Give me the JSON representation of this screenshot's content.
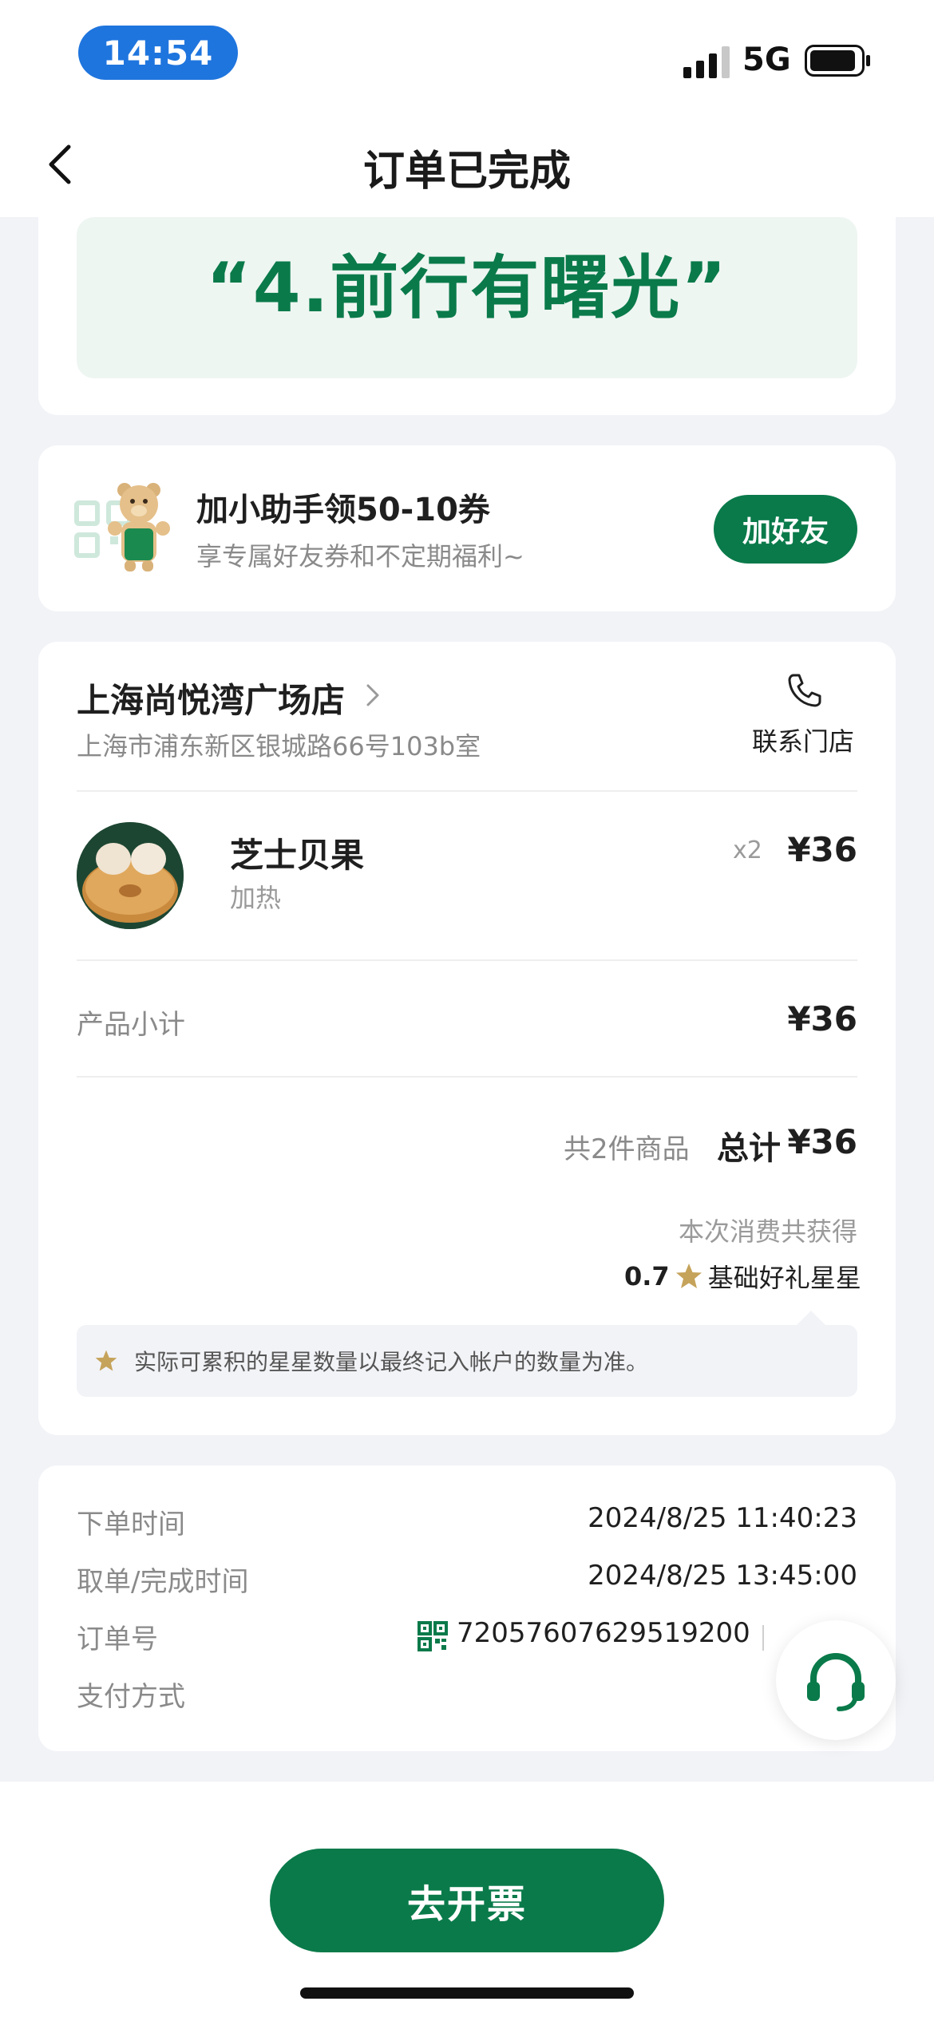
{
  "status_bar": {
    "time": "14:54",
    "network": "5G"
  },
  "nav": {
    "title": "订单已完成"
  },
  "quote": {
    "text": "“4.前行有曙光”"
  },
  "promo": {
    "title": "加小助手领50-10券",
    "subtitle": "享专属好友券和不定期福利~",
    "button": "加好友"
  },
  "store": {
    "name": "上海尚悦湾广场店",
    "address": "上海市浦东新区银城路66号103b室",
    "contact_label": "联系门店"
  },
  "product": {
    "name": "芝士贝果",
    "option": "加热",
    "qty": "x2",
    "price": "¥36"
  },
  "summary": {
    "subtotal_label": "产品小计",
    "subtotal_value": "¥36",
    "items_count": "共2件商品",
    "total_label": "总计",
    "total_value": "¥36",
    "earn_label": "本次消费共获得",
    "stars_value": "0.7",
    "stars_label": "基础好礼星星",
    "notice": "实际可累积的星星数量以最终记入帐户的数量为准。"
  },
  "order_info": {
    "order_time_label": "下单时间",
    "order_time_value": "2024/8/25 11:40:23",
    "complete_time_label": "取单/完成时间",
    "complete_time_value": "2024/8/25 13:45:00",
    "order_no_label": "订单号",
    "order_no_value": "72057607629519200",
    "payment_label": "支付方式"
  },
  "bottom": {
    "invoice_button": "去开票"
  },
  "colors": {
    "brand_green": "#0a7a4a",
    "status_blue": "#1f75de",
    "star_gold": "#c5a35a"
  }
}
